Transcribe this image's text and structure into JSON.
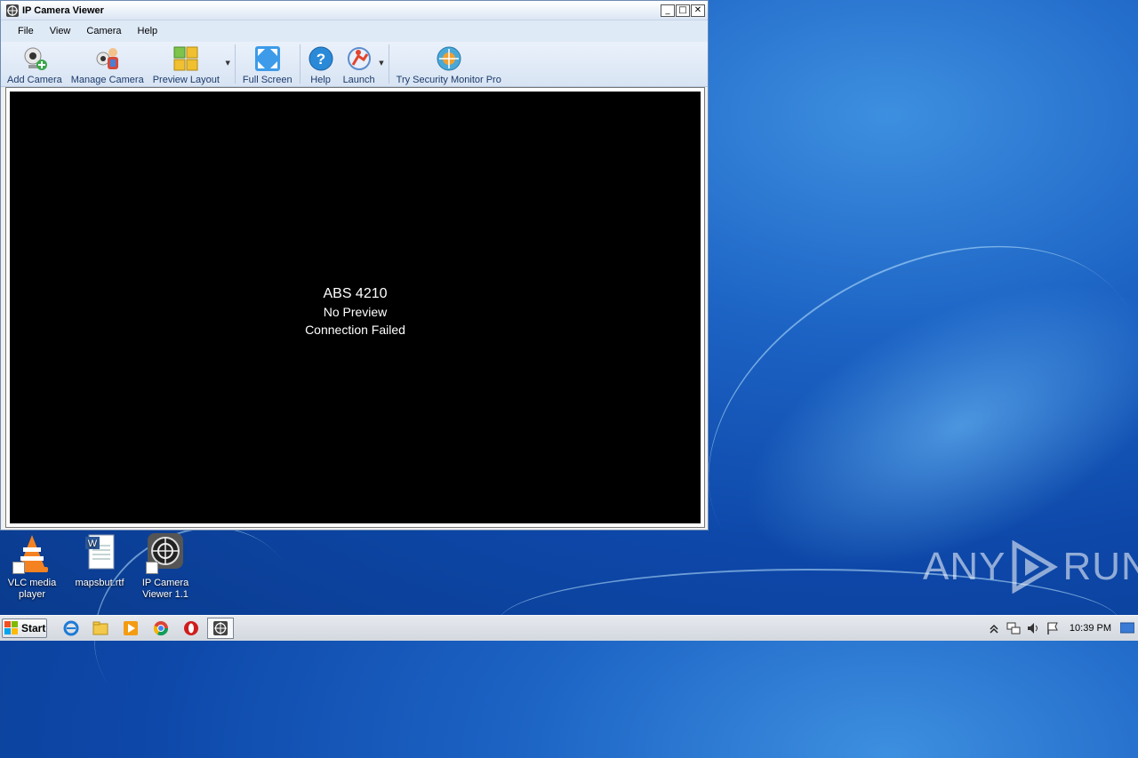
{
  "window": {
    "title": "IP Camera Viewer",
    "controls": {
      "minimize": "_",
      "maximize": "□",
      "close": "✕"
    }
  },
  "menu": [
    "File",
    "View",
    "Camera",
    "Help"
  ],
  "toolbar": {
    "add_camera": {
      "label": "Add Camera",
      "icon": "webcam-add-icon"
    },
    "manage_camera": {
      "label": "Manage Camera",
      "icon": "manage-camera-icon"
    },
    "preview_layout": {
      "label": "Preview Layout",
      "icon": "grid-layout-icon"
    },
    "full_screen": {
      "label": "Full Screen",
      "icon": "fullscreen-icon"
    },
    "help": {
      "label": "Help",
      "icon": "help-icon"
    },
    "launch": {
      "label": "Launch",
      "icon": "launch-icon"
    },
    "try_pro": {
      "label": "Try Security Monitor Pro",
      "icon": "security-monitor-icon"
    }
  },
  "viewer": {
    "camera_name": "ABS 4210",
    "preview_status": "No Preview",
    "connection_status": "Connection Failed"
  },
  "desktop": {
    "icons": [
      {
        "label": "VLC media player",
        "icon": "vlc-icon"
      },
      {
        "label": "mapsbut.rtf",
        "icon": "word-document-icon"
      },
      {
        "label": "IP Camera Viewer 1.1",
        "icon": "ip-camera-viewer-icon"
      }
    ],
    "watermark": {
      "left": "ANY",
      "right": "RUN"
    }
  },
  "taskbar": {
    "start_label": "Start",
    "pinned": [
      "internet-explorer-icon",
      "folder-icon",
      "media-player-icon",
      "chrome-icon",
      "opera-icon",
      "ip-camera-viewer-icon"
    ],
    "clock": "10:39 PM"
  },
  "colors": {
    "viewer_bg": "#000000",
    "desktop_blue": "#0d47a8",
    "toolbar_label": "#1b3a6b"
  }
}
